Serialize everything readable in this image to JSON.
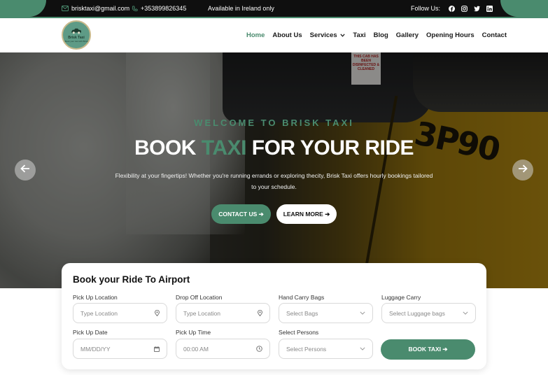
{
  "topbar": {
    "email": "brisktaxi@gmail.com",
    "phone": "+353899826345",
    "availability": "Available in Ireland only",
    "follow_label": "Follow Us:",
    "social_icons": [
      "facebook-icon",
      "instagram-icon",
      "twitter-icon",
      "linkedin-icon"
    ]
  },
  "logo": {
    "text": "Brisk Taxi",
    "subtext": "Book your taxi with Brisk"
  },
  "nav": {
    "items": [
      "Home",
      "About Us",
      "Services",
      "Taxi",
      "Blog",
      "Gallery",
      "Opening Hours",
      "Contact"
    ],
    "active": "Home"
  },
  "hero": {
    "welcome": "WELCOME TO BRISK TAXI",
    "headline_before": "BOOK ",
    "headline_highlight": "TAXI",
    "headline_after": " FOR YOUR RIDE",
    "description": "Flexibility at your fingertips! Whether you're running errands or exploring thecity, Brisk Taxi offers hourly bookings tailored to your schedule.",
    "contact_button": "CONTACT US ➔",
    "learn_button": "LEARN MORE ➔",
    "sticker_text": "THIS CAB HAS BEEN DISINFECTED & CLEANED",
    "plate_text": "3P90"
  },
  "booking": {
    "title": "Book your Ride To Airport",
    "pickup_location_label": "Pick Up Location",
    "pickup_location_placeholder": "Type Location",
    "dropoff_location_label": "Drop Off Location",
    "dropoff_location_placeholder": "Type Location",
    "hand_bags_label": "Hand Carry Bags",
    "hand_bags_value": "Select Bags",
    "luggage_label": "Luggage Carry",
    "luggage_value": "Select Luggage bags",
    "pickup_date_label": "Pick Up Date",
    "pickup_date_placeholder": "MM/DD/YY",
    "pickup_time_label": "Pick Up Time",
    "pickup_time_placeholder": "00:00 AM",
    "persons_label": "Select Persons",
    "persons_value": "Select Persons",
    "book_button": "BOOK TAXI ➔"
  },
  "colors": {
    "accent": "#4a8b6e",
    "topbar_bg": "#0f0f0f",
    "text_dark": "#111111"
  }
}
